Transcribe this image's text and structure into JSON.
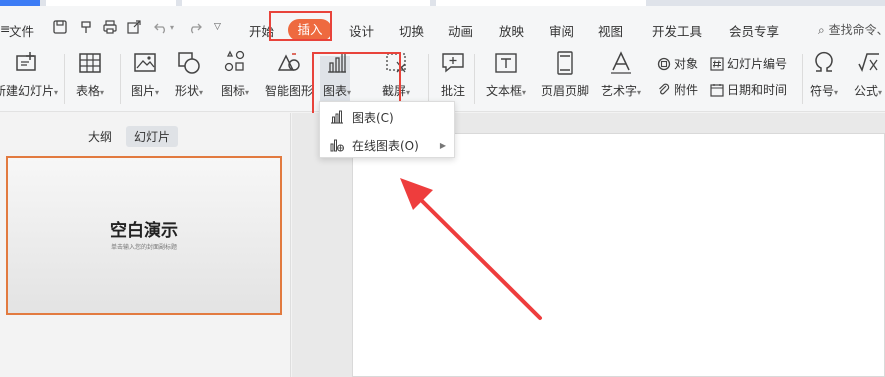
{
  "menu": {
    "file_label": "文件",
    "tabs": [
      "开始",
      "插入",
      "设计",
      "切换",
      "动画",
      "放映",
      "审阅",
      "视图",
      "开发工具",
      "会员专享"
    ],
    "active_tab": "插入",
    "search_placeholder": "查找命令、搜"
  },
  "ribbon": {
    "new_slide": "新建幻灯片",
    "table": "表格",
    "picture": "图片",
    "shape": "形状",
    "icon": "图标",
    "smart_graphic": "智能图形",
    "chart": "图表",
    "screenshot": "截屏",
    "comment": "批注",
    "textbox": "文本框",
    "header_footer": "页眉页脚",
    "wordart": "艺术字",
    "object": "对象",
    "attachment": "附件",
    "slide_number": "幻灯片编号",
    "date_time": "日期和时间",
    "symbol": "符号",
    "formula": "公式"
  },
  "left_panel": {
    "tab_outline": "大纲",
    "tab_slides": "幻灯片",
    "slide_title": "空白演示",
    "slide_subtitle": "单击输入您的封面副标题"
  },
  "dropdown": {
    "item_chart": "图表(C)",
    "item_online_chart": "在线图表(O)"
  },
  "colors": {
    "accent": "#ee6a3f",
    "highlight_box": "#e8433b",
    "thumb_border": "#e27a3f"
  }
}
